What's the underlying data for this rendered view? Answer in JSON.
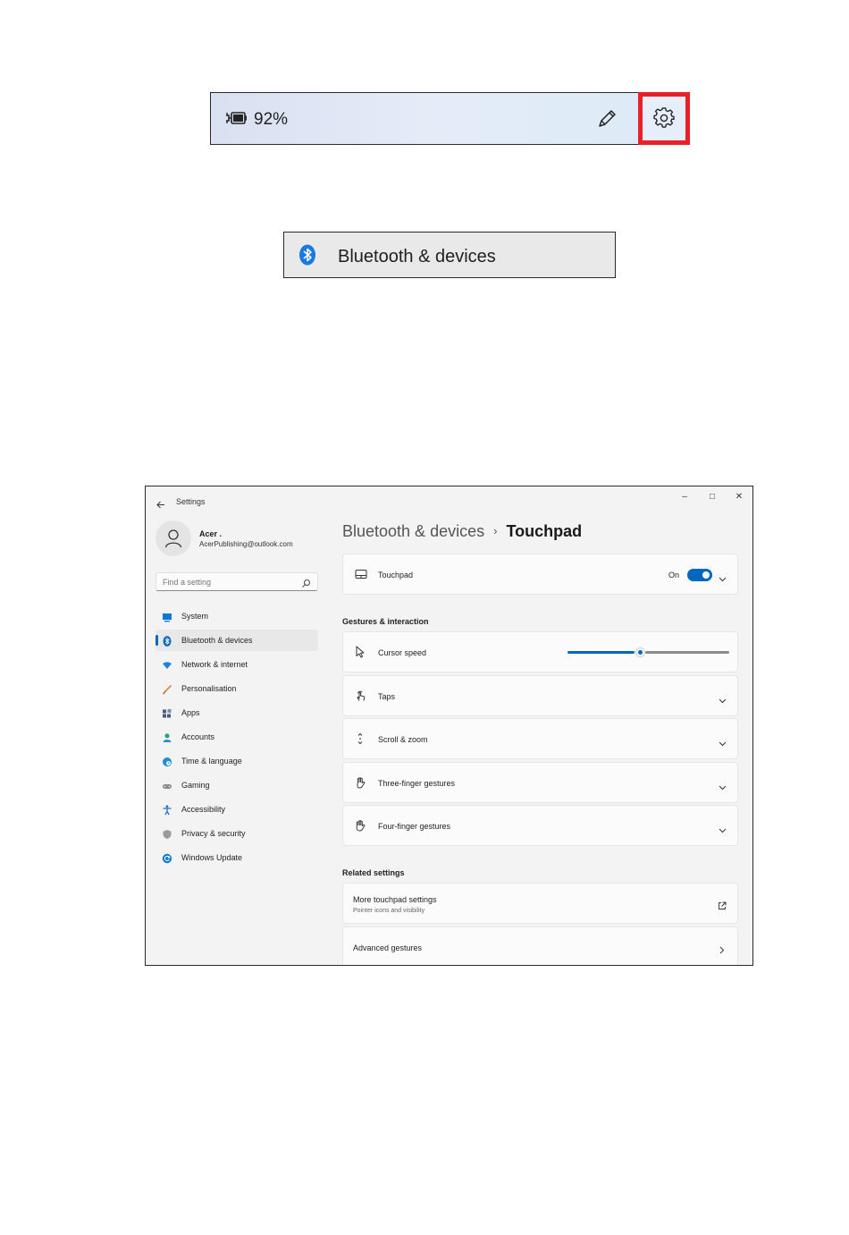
{
  "quick_settings": {
    "battery_level": "92%",
    "battery_percent": 92
  },
  "bluetooth_tile": {
    "label": "Bluetooth & devices"
  },
  "window": {
    "app_title": "Settings",
    "controls": {
      "minimize": "–",
      "maximize": "□",
      "close": "✕"
    }
  },
  "profile": {
    "name": "Acer .",
    "email": "AcerPublishing@outlook.com"
  },
  "search": {
    "placeholder": "Find a setting"
  },
  "sidebar": {
    "items": [
      {
        "label": "System",
        "icon": "monitor-icon",
        "color": "#0078d4"
      },
      {
        "label": "Bluetooth & devices",
        "icon": "bluetooth-icon",
        "color": "#0067c0",
        "active": true
      },
      {
        "label": "Network & internet",
        "icon": "wifi-icon",
        "color": "#0078d4"
      },
      {
        "label": "Personalisation",
        "icon": "brush-icon",
        "color": "#e08a3c"
      },
      {
        "label": "Apps",
        "icon": "apps-icon",
        "color": "#4a5a7a"
      },
      {
        "label": "Accounts",
        "icon": "person-icon",
        "color": "#2fa37a"
      },
      {
        "label": "Time & language",
        "icon": "globe-clock-icon",
        "color": "#1d8fd1"
      },
      {
        "label": "Gaming",
        "icon": "controller-icon",
        "color": "#8a8a8a"
      },
      {
        "label": "Accessibility",
        "icon": "accessibility-icon",
        "color": "#1f6fd1"
      },
      {
        "label": "Privacy & security",
        "icon": "shield-icon",
        "color": "#8a8a8a"
      },
      {
        "label": "Windows Update",
        "icon": "update-icon",
        "color": "#0f7dd4"
      }
    ]
  },
  "main": {
    "breadcrumb": {
      "parent": "Bluetooth & devices",
      "separator": "›",
      "current": "Touchpad"
    },
    "touchpad_card": {
      "label": "Touchpad",
      "state_text": "On",
      "enabled": true
    },
    "gestures_section": {
      "title": "Gestures & interaction",
      "cursor_speed": {
        "label": "Cursor speed",
        "value_fraction": 0.45
      },
      "items": [
        {
          "label": "Taps",
          "icon": "tap-icon"
        },
        {
          "label": "Scroll & zoom",
          "icon": "scroll-icon"
        },
        {
          "label": "Three-finger gestures",
          "icon": "three-finger-icon"
        },
        {
          "label": "Four-finger gestures",
          "icon": "four-finger-icon"
        }
      ]
    },
    "related_section": {
      "title": "Related settings",
      "more_touchpad": {
        "label": "More touchpad settings",
        "sub": "Pointer icons and visibility"
      },
      "advanced_gestures": {
        "label": "Advanced gestures"
      }
    }
  },
  "colors": {
    "accent": "#0067c0",
    "highlight_border": "#e8202a"
  }
}
